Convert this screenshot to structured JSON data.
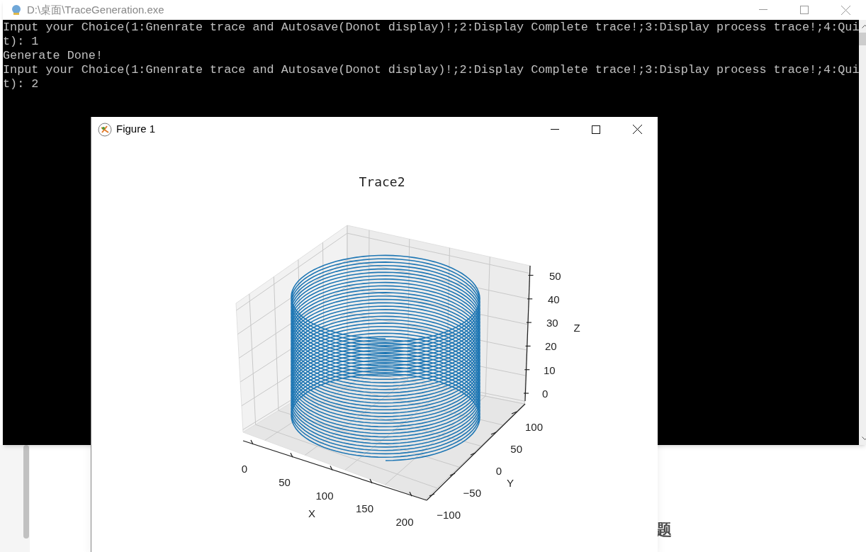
{
  "console": {
    "title": "D:\\桌面\\TraceGeneration.exe",
    "lines": [
      "Input your Choice(1:Gnenrate trace and Autosave(Donot display)!;2:Display Complete trace!;3:Display process trace!;4:Qui",
      "t): 1",
      "Generate Done!",
      "Input your Choice(1:Gnenrate trace and Autosave(Donot display)!;2:Display Complete trace!;3:Display process trace!;4:Qui",
      "t): 2"
    ]
  },
  "figure": {
    "title": "Figure 1",
    "plot": {
      "title": "Trace2",
      "x_axis": {
        "label": "X",
        "ticks": [
          "0",
          "50",
          "100",
          "150",
          "200"
        ]
      },
      "y_axis": {
        "label": "Y",
        "ticks": [
          "100",
          "50",
          "0",
          "−50",
          "−100"
        ]
      },
      "z_axis": {
        "label": "Z",
        "ticks": [
          "50",
          "40",
          "30",
          "20",
          "10",
          "0"
        ]
      }
    }
  },
  "background_page": {
    "text_fragments": [
      "题"
    ]
  }
}
